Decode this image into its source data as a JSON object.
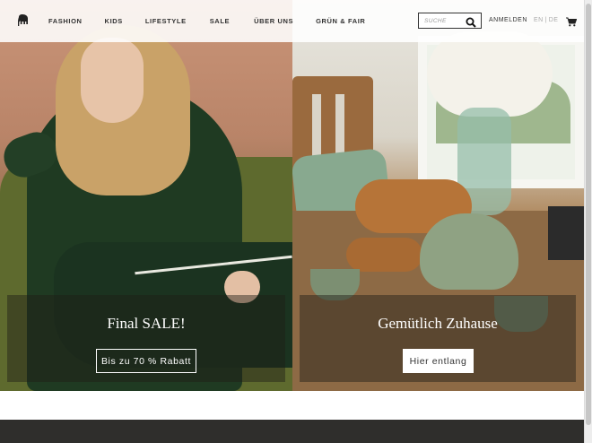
{
  "nav": {
    "logo_icon": "elephant-icon",
    "items": [
      {
        "label": "FASHION"
      },
      {
        "label": "KIDS"
      },
      {
        "label": "LIFESTYLE"
      },
      {
        "label": "SALE"
      },
      {
        "label": "ÜBER UNS"
      },
      {
        "label": "GRÜN & FAIR"
      }
    ],
    "search": {
      "placeholder": "SUCHE",
      "value": "",
      "icon": "search-icon"
    },
    "login_label": "ANMELDEN",
    "languages": [
      "EN",
      "DE"
    ],
    "language_separator": "|",
    "active_language": "DE",
    "cart_icon": "shopping-cart-icon"
  },
  "hero": {
    "left": {
      "title": "Final SALE!",
      "button_label": "Bis zu 70 % Rabatt"
    },
    "right": {
      "title": "Gemütlich Zuhause",
      "button_label": "Hier entlang"
    }
  },
  "colors": {
    "nav_background": "#ffffff",
    "text": "#333333",
    "footer_background": "#2f2e2c",
    "inactive_language": "#aaaaaa"
  }
}
